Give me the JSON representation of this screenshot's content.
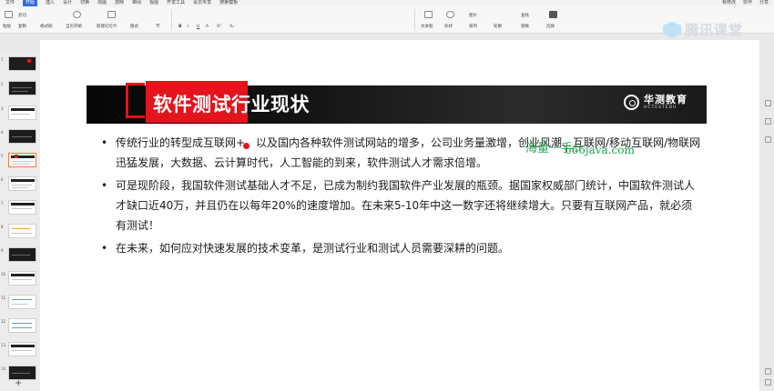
{
  "menubar": {
    "items": [
      "文件",
      "",
      "",
      "",
      "开始",
      "插入",
      "设计",
      "切换",
      "动画",
      "放映",
      "审阅",
      "视图",
      "开发工具",
      "会员专享",
      "",
      "搜索模板"
    ],
    "active_index": 4,
    "right": [
      "有修改",
      "协作",
      "分享"
    ]
  },
  "ribbon": {
    "left_labels": [
      "粘贴",
      "剪切",
      "复制",
      "格式刷",
      "当页开始",
      "新建幻灯片",
      "版式",
      "节"
    ],
    "font_labels": [
      "B",
      "I",
      "U",
      "A",
      "X²",
      "X₂"
    ],
    "right_labels": [
      "文本框",
      "形状",
      "排列",
      "轮廓",
      "图片",
      "查找",
      "替换",
      "选择"
    ],
    "watermark": "腾讯课堂"
  },
  "slide_numbers": [
    "1",
    "2",
    "3",
    "4",
    "5",
    "6",
    "7",
    "8",
    "9",
    "10",
    "11",
    "12",
    "13",
    "14"
  ],
  "slide": {
    "title": "软件测试行业现状",
    "brand_name": "华测教育",
    "brand_sub": "HCTESTEDU",
    "bullets": [
      "传统行业的转型成互联网+，以及国内各种软件测试网站的增多，公司业务量激增，创业风潮、互联网/移动互联网/物联网迅猛发展，大数据、云计算时代，人工智能的到来，软件测试人才需求倍增。",
      "可是现阶段，我国软件测试基础人才不足，已成为制约我国软件产业发展的瓶颈。据国家权威部门统计，中国软件测试人才缺口近40万，并且仍在以每年20%的速度增加。在未来5-10年中这一数字还将继续增大。只要有互联网产品，就必须有测试！",
      "在未来，如何应对快速发展的技术变革，是测试行业和测试人员需要深耕的问题。"
    ],
    "overlay_watermark": "海量一手：",
    "overlay_url": "666java.com"
  },
  "colors": {
    "accent_red": "#e3141c",
    "active_tab": "#2f6be0",
    "watermark_green": "#1aa34a"
  }
}
